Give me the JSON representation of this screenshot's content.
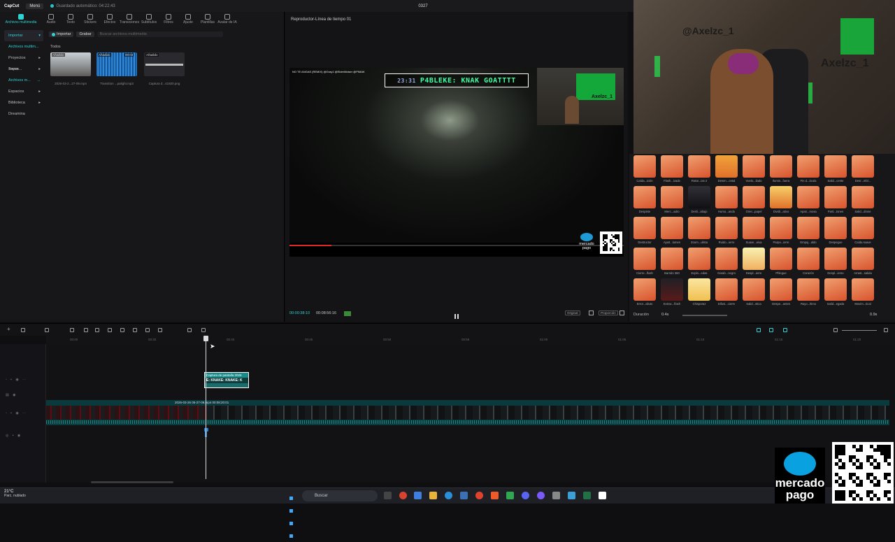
{
  "app": {
    "logo": "CapCut",
    "menu_label": "Menú",
    "autosave": "Guardado automático: 04:22:43",
    "project_title": "0327"
  },
  "toolbar": {
    "items": [
      {
        "label": "Archivos multimedia",
        "active": true
      },
      {
        "label": "Audio"
      },
      {
        "label": "Texto"
      },
      {
        "label": "Stickers"
      },
      {
        "label": "Efectos"
      },
      {
        "label": "Transiciones"
      },
      {
        "label": "Subtítulos"
      },
      {
        "label": "Filtros"
      },
      {
        "label": "Ajuste"
      },
      {
        "label": "Plantillas"
      },
      {
        "label": "Avatar de IA"
      }
    ]
  },
  "sidebar": {
    "items": [
      {
        "label": "Importar",
        "selected": true,
        "chev": "▾"
      },
      {
        "label": "Archivos multim..."
      },
      {
        "label": "Proyectos secun...",
        "chev": "▸"
      },
      {
        "label": "Tuyos",
        "chev": "▸"
      },
      {
        "label": "Archivos m...",
        "chev": "→"
      },
      {
        "label": "Espacios",
        "chev": "▸"
      },
      {
        "label": "Biblioteca",
        "chev": "▸"
      },
      {
        "label": "Dreamina"
      }
    ]
  },
  "media": {
    "import_label": "Importar",
    "record_label": "Grabar",
    "search_placeholder": "Buscar archivos multimedia",
    "section_label": "Todos",
    "items": [
      {
        "tag": "Añadido",
        "name": "2026-03-2...27-09.mp4"
      },
      {
        "tag": "Añadido",
        "duration": "00:03",
        "name": "Transition ...palight.mp3"
      },
      {
        "tag": "Añadido",
        "name": "Captura d...41920.png"
      }
    ]
  },
  "player": {
    "title": "Reproductor-Línea de tiempo 01",
    "overlay_time": "23:31",
    "overlay_text": "P4BLEKE: KNAK GOATTTT",
    "video_top_label": "NO TE ANGAS (REMIX) @Gray1 @ElderMoiser @PIMAK",
    "sponsor_text": "mercado pago",
    "current_time": "00:00:38:10",
    "total_time": "00:08:56:16",
    "btn_ratio": "Original",
    "btn_proportion": "Proporción",
    "cam_sign": "Axelzc_1"
  },
  "webcam": {
    "sign_top": "@Axelzc_1",
    "sign_side": "Axelzc_1"
  },
  "effects": {
    "labels": [
      "Caída...ición",
      "Flash...ivado",
      "Rotar...ias 2",
      "Desen...ontal",
      "Vuelo...ilado",
      "Ilumin...fuera",
      "Fin d...ácula",
      "Salid...cente",
      "Desr...mbl...",
      "Despiste",
      "Merc...adro",
      "Desli...abajo",
      "Humo...ando",
      "Griet...papel",
      "Dividi...ativo",
      "Apari...mosa",
      "Parti...tones",
      "Salid...drose",
      "Destructor",
      "Ajust...lumen",
      "Zoom...ulista",
      "Ruido...ierre",
      "Suave...eiva",
      "Parpa...ierre",
      "Empuj...aldo",
      "Despegue",
      "Caída suave",
      "Cierre...flash",
      "Barrido 360",
      "Explo...edas",
      "Garab...negro",
      "Despl...ierre",
      "Phlegue",
      "Corazón",
      "Despl...ierso",
      "Arrast...salida",
      "Error...aliuto",
      "Extrac...flash",
      "Chisporaz",
      "Difusi...cierre",
      "Salid...stica",
      "Despe...antes",
      "Rayo...ltimo",
      "Salid...egada",
      "Movim...tical"
    ],
    "duration_label": "Duración",
    "duration_value": "0.4s",
    "duration_value_right": "0.9s"
  },
  "timeline": {
    "ruler_ticks": [
      "00:00",
      "00:30",
      "00:40",
      "00:45",
      "00:50",
      "00:55",
      "01:00",
      "01:05",
      "01:10",
      "01:15",
      "01:20"
    ],
    "text_clip_title": "Captura de pantalla 2026",
    "text_clip_text": "E: KNAKE: KNAKE: K",
    "main_clip_label": "2026-03-26 05-27-09.mp4   00:08:20:01"
  },
  "taskbar": {
    "temp": "21°C",
    "weather": "Parc. nublado",
    "search_label": "Buscar"
  },
  "overlay": {
    "sponsor_big": "mercado pago"
  },
  "colors": {
    "accent": "#2fd3d3",
    "clip": "#0b3a3c",
    "effect": "#e06a3a"
  }
}
